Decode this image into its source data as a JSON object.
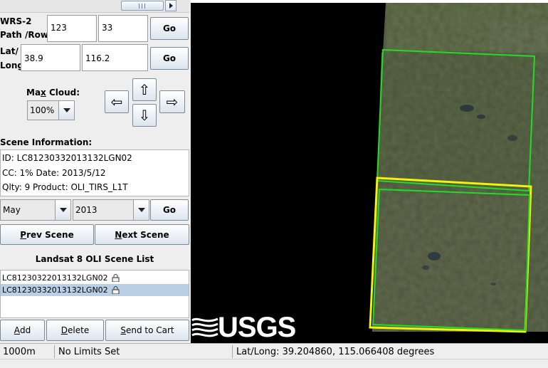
{
  "wrs": {
    "label_line1": "WRS-2",
    "label_line2": "Path /Row:",
    "path": "123",
    "row": "33",
    "go": "Go"
  },
  "latlong": {
    "label_line1": "Lat/",
    "label_line2": "Long:",
    "lat": "38.9",
    "long": "116.2",
    "go": "Go"
  },
  "cloud": {
    "label_pre": "Ma",
    "label_underline": "x",
    "label_post": " Cloud:",
    "value": "100%"
  },
  "nav": {
    "up": "⇧",
    "down": "⇩",
    "left": "⇦",
    "right": "⇨"
  },
  "scene_info": {
    "heading": "Scene Information:",
    "id_line": "ID: LC81230332013132LGN02",
    "cc_line": "CC: 1%   Date: 2013/5/12",
    "qlty_line": "Qlty: 9  Product:  OLI_TIRS_L1T"
  },
  "date_select": {
    "month": "May",
    "year": "2013",
    "go": "Go"
  },
  "scene_nav": {
    "prev_u": "P",
    "prev_rest": "rev Scene",
    "next_u": "N",
    "next_rest": "ext Scene"
  },
  "scene_list": {
    "heading": "Landsat 8 OLI Scene List",
    "items": [
      {
        "label": "LC81230322013132LGN02"
      },
      {
        "label": "LC81230332013132LGN02"
      }
    ]
  },
  "actions": {
    "add_u": "A",
    "add_rest": "dd",
    "delete_u": "D",
    "delete_rest": "elete",
    "send_u": "S",
    "send_rest": "end to Cart"
  },
  "map": {
    "logo_text": "USGS"
  },
  "status_bar": {
    "scale": "1000m",
    "limits": "No Limits Set",
    "latlong": "Lat/Long:  39.204860,  115.066408 degrees"
  },
  "colors": {
    "green_outline": "#22dd22",
    "yellow_outline": "#f2f20a",
    "map_background": "#000000"
  }
}
